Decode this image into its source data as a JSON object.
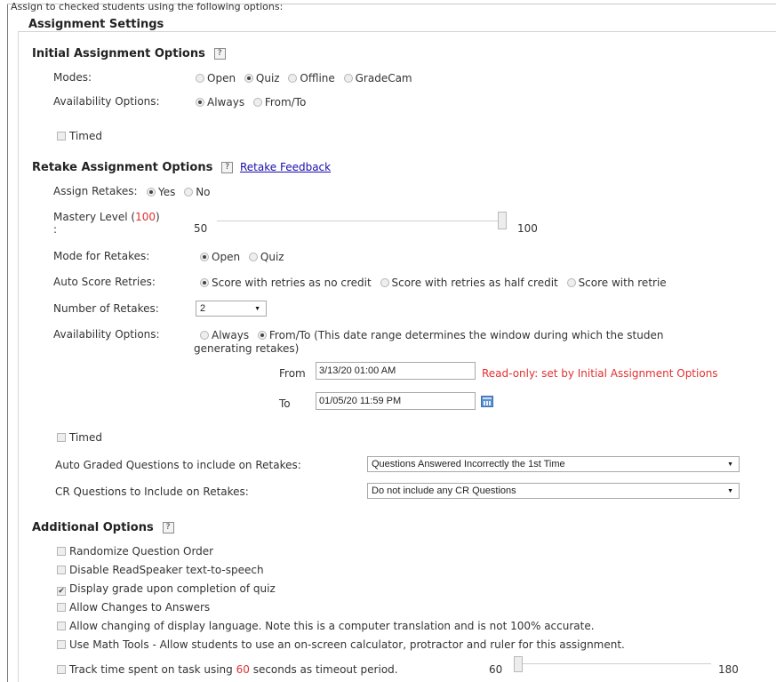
{
  "header": {
    "intro": "Assign to checked students using the following options:",
    "legend": "Assignment Settings"
  },
  "initial": {
    "heading": "Initial Assignment Options",
    "help_icon": "?",
    "modes_label": "Modes:",
    "modes": [
      {
        "label": "Open",
        "checked": false
      },
      {
        "label": "Quiz",
        "checked": true
      },
      {
        "label": "Offline",
        "checked": false
      },
      {
        "label": "GradeCam",
        "checked": false
      }
    ],
    "availability_label": "Availability Options:",
    "availability": [
      {
        "label": "Always",
        "checked": true
      },
      {
        "label": "From/To",
        "checked": false
      }
    ],
    "timed_label": "Timed"
  },
  "retake": {
    "heading": "Retake Assignment Options",
    "help_icon": "?",
    "feedback_link": "Retake Feedback",
    "assign_label": "Assign Retakes:",
    "assign_options": [
      {
        "label": "Yes",
        "checked": true
      },
      {
        "label": "No",
        "checked": false
      }
    ],
    "mastery_label_pre": "Mastery Level (",
    "mastery_value": "100",
    "mastery_label_post": ")",
    "mastery_colon": ":",
    "mastery_min": "50",
    "mastery_max": "100",
    "mastery_level_fraction": 1.0,
    "mode_label": "Mode for Retakes:",
    "mode_options": [
      {
        "label": "Open",
        "checked": true
      },
      {
        "label": "Quiz",
        "checked": false
      }
    ],
    "autoscore_label": "Auto Score Retries:",
    "autoscore_options": [
      {
        "label": "Score with retries as no credit",
        "checked": true
      },
      {
        "label": "Score with retries as half credit",
        "checked": false
      },
      {
        "label": "Score with retrie",
        "checked": false
      }
    ],
    "num_label": "Number of Retakes:",
    "num_value": "2",
    "avail_label": "Availability Options:",
    "avail_always": "Always",
    "avail_fromto": "From/To (This date range determines the window during which the studen",
    "avail_fromto_line2": "generating retakes)",
    "from_label": "From",
    "from_value": "3/13/20 01:00 AM",
    "readonly_note": "Read-only: set by Initial Assignment Options",
    "to_label": "To",
    "to_value": "01/05/20 11:59 PM",
    "timed_label": "Timed",
    "auto_graded_label": "Auto Graded Questions to include on Retakes:",
    "auto_graded_value": "Questions Answered Incorrectly the 1st Time",
    "cr_label": "CR Questions to Include on Retakes:",
    "cr_value": "Do not include any CR Questions"
  },
  "additional": {
    "heading": "Additional Options",
    "help_icon": "?",
    "items": [
      {
        "label": "Randomize Question Order",
        "checked": false
      },
      {
        "label": "Disable ReadSpeaker text-to-speech",
        "checked": false
      },
      {
        "label": "Display grade upon completion of quiz",
        "checked": true
      },
      {
        "label": "Allow Changes to Answers",
        "checked": false
      },
      {
        "label": "Allow changing of display language. Note this is a computer translation and is not 100% accurate.",
        "checked": false
      },
      {
        "label": "Use Math Tools - Allow students to use an on-screen calculator, protractor and ruler for this assignment.",
        "checked": false
      }
    ],
    "track_pre": "Track time spent on task using ",
    "track_value": "60",
    "track_post": " seconds as timeout period.",
    "track_min": "60",
    "track_max": "180",
    "track_level_fraction": 0.0
  },
  "colors": {
    "link": "#1a0dab",
    "readonly": "#e23030"
  },
  "icons": {
    "help": "help-icon",
    "calendar": "calendar-icon",
    "dropdown": "chevron-down-icon"
  }
}
